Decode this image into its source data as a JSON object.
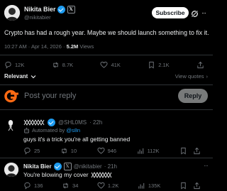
{
  "tweet": {
    "author_name": "Nikita Bier",
    "author_handle": "@nikitabier",
    "subscribe_label": "Subscribe",
    "text": "Crypto has had a rough year. Maybe we should launch something to fix it.",
    "time": "10:27 AM · Apr 14, 2026 · ",
    "views_count": "5.2M",
    "views_label": " Views",
    "stats": {
      "replies": "12K",
      "reposts": "8.7K",
      "likes": "41K",
      "bookmarks": "2.1K"
    },
    "relevant_label": "Relevant",
    "view_quotes_label": "View quotes"
  },
  "composer": {
    "placeholder": "Post your reply",
    "reply_label": "Reply"
  },
  "replies": [
    {
      "handle": "@SHL0MS",
      "time": "· 22h",
      "automated_prefix": "Automated by ",
      "automated_by": "@s8n",
      "text": "guys it's a trick you're all getting banned",
      "stats": {
        "replies": "25",
        "reposts": "10",
        "likes": "946",
        "views": "112K"
      }
    },
    {
      "author_name": "Nikita Bier",
      "handle": "@nikitabier",
      "time": "· 21h",
      "text": "You're blowing my cover",
      "stats": {
        "replies": "136",
        "reposts": "34",
        "likes": "1.2K",
        "views": "135K"
      }
    }
  ],
  "colors": {
    "accent": "#1d9bf0",
    "background": "#000000",
    "text": "#e7e9ea",
    "muted": "#71767b",
    "logo_orange": "#ff6a13"
  }
}
